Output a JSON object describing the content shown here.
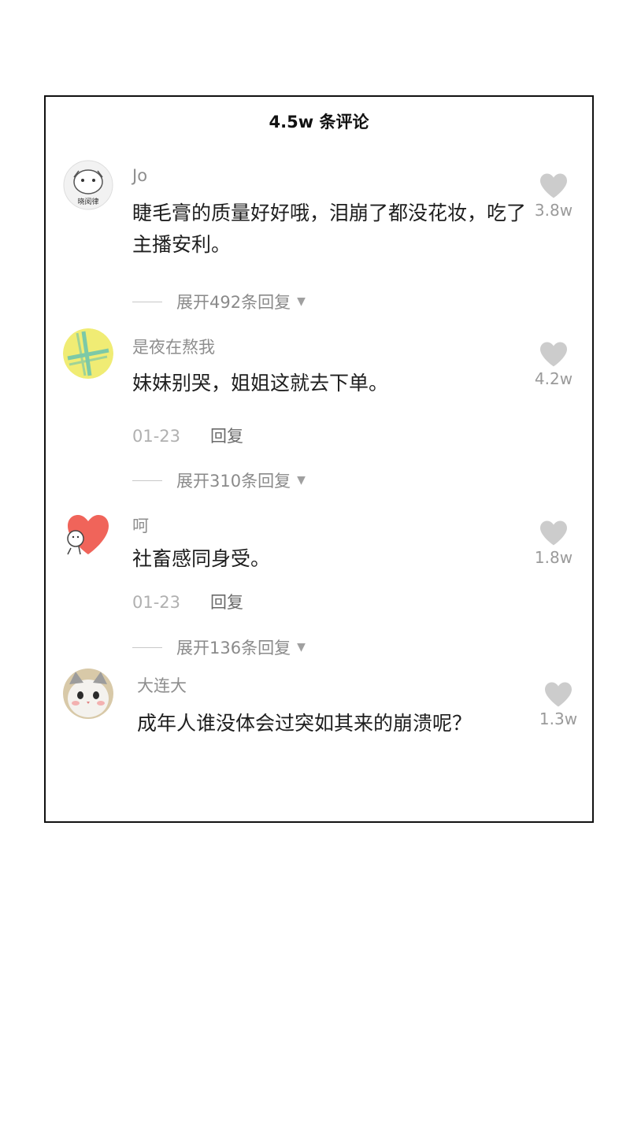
{
  "header": {
    "title": "4.5w 条评论"
  },
  "comments": [
    {
      "username": "Jo",
      "text": "睫毛膏的质量好好哦，泪崩了都没花妆，吃了主播安利。",
      "likes": "3.8w",
      "expand": "展开492条回复",
      "avatar_caption": "晓阅律"
    },
    {
      "username": "是夜在熬我",
      "text": "妹妹别哭，姐姐这就去下单。",
      "likes": "4.2w",
      "date": "01-23",
      "reply": "回复",
      "expand": "展开310条回复"
    },
    {
      "username": "呵",
      "text": "社畜感同身受。",
      "likes": "1.8w",
      "date": "01-23",
      "reply": "回复",
      "expand": "展开136条回复"
    },
    {
      "username": "大连大",
      "text": "成年人谁没体会过突如其来的崩溃呢？",
      "likes": "1.3w"
    }
  ],
  "colors": {
    "heart": "#cccccc",
    "avatar2_bg": "#f0ec74",
    "avatar2_cross": "#7cc9a7",
    "avatar3_heart": "#f0645a"
  }
}
